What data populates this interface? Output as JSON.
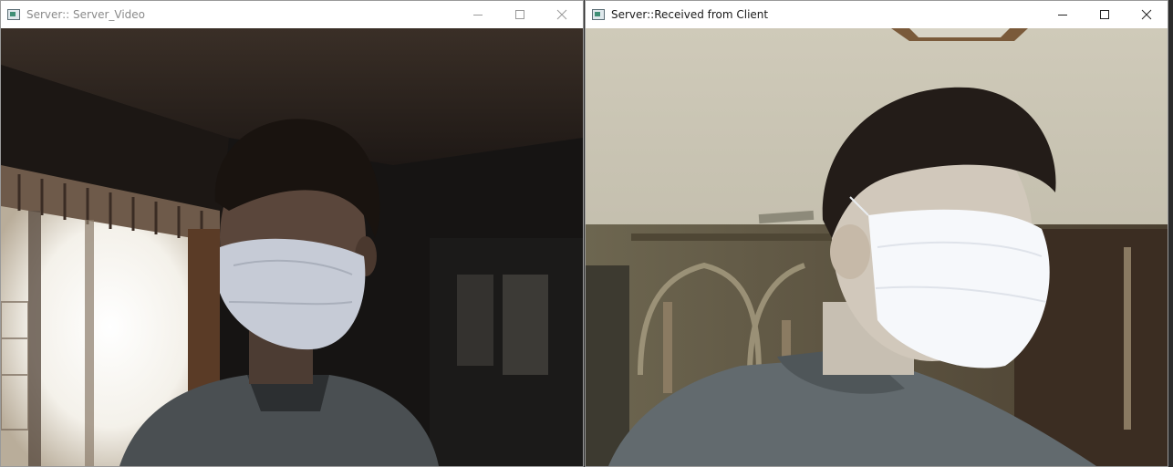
{
  "windows": [
    {
      "title": "Server:: Server_Video",
      "state": "inactive",
      "icon": "app-window-icon",
      "controls": [
        "minimize-icon",
        "maximize-icon",
        "close-icon"
      ]
    },
    {
      "title": "Server::Received from Client",
      "state": "active",
      "icon": "app-window-icon",
      "controls": [
        "minimize-icon",
        "maximize-icon",
        "close-icon"
      ]
    }
  ]
}
